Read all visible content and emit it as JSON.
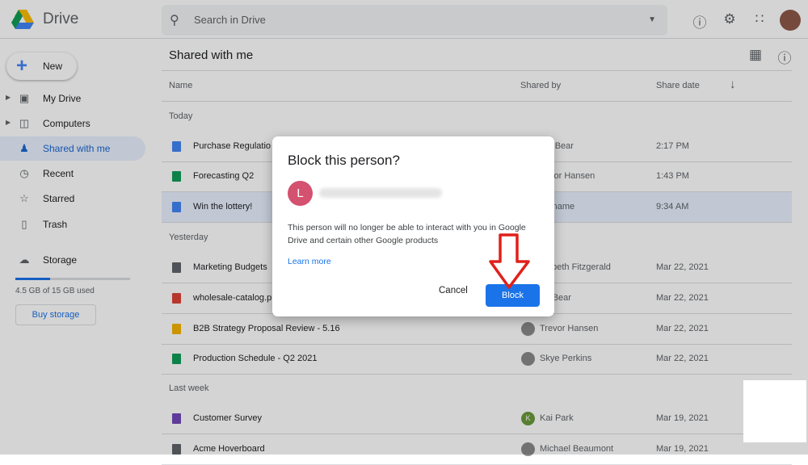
{
  "app": {
    "name": "Drive",
    "search_placeholder": "Search in Drive"
  },
  "sidebar": {
    "new_label": "New",
    "items": [
      {
        "label": "My Drive",
        "icon": "my-drive-icon"
      },
      {
        "label": "Computers",
        "icon": "computer-icon"
      },
      {
        "label": "Shared with me",
        "icon": "people-icon",
        "active": true
      },
      {
        "label": "Recent",
        "icon": "clock-icon"
      },
      {
        "label": "Starred",
        "icon": "star-icon"
      },
      {
        "label": "Trash",
        "icon": "trash-icon"
      },
      {
        "label": "Storage",
        "icon": "cloud-icon"
      }
    ],
    "storage_used": "4.5 GB of 15 GB used",
    "storage_fraction": 0.3,
    "buy_storage": "Buy storage"
  },
  "main": {
    "title": "Shared with me",
    "columns": {
      "name": "Name",
      "shared_by": "Shared by",
      "share_date": "Share date"
    },
    "sections": {
      "today": "Today",
      "yesterday": "Yesterday",
      "last_week": "Last week"
    },
    "rows": [
      {
        "name": "Purchase Regulatio",
        "type": "doc",
        "shared_by": "r Bear",
        "date": "2:17 PM"
      },
      {
        "name": "Forecasting Q2",
        "type": "sheet",
        "shared_by": "vor Hansen",
        "date": "1:43 PM"
      },
      {
        "name": "Win the lottery!",
        "type": "doc",
        "shared_by": "rname",
        "date": "9:34 AM",
        "selected": true
      },
      {
        "name": "Marketing Budgets",
        "type": "shared-folder",
        "shared_by": "abeth Fitzgerald",
        "date": "Mar 22, 2021"
      },
      {
        "name": "wholesale-catalog.p",
        "type": "pdf",
        "shared_by": "r Bear",
        "date": "Mar 22, 2021"
      },
      {
        "name": "B2B Strategy Proposal Review - 5.16",
        "type": "slides",
        "shared_by": "Trevor Hansen",
        "date": "Mar 22, 2021"
      },
      {
        "name": "Production Schedule - Q2 2021",
        "type": "sheet",
        "shared_by": "Skye Perkins",
        "date": "Mar 22, 2021"
      },
      {
        "name": "Customer Survey",
        "type": "form",
        "shared_by": "Kai Park",
        "avatar_letter": "K",
        "date": "Mar 19, 2021"
      },
      {
        "name": "Acme Hoverboard",
        "type": "shared-folder",
        "shared_by": "Michael Beaumont",
        "date": "Mar 19, 2021"
      }
    ]
  },
  "dialog": {
    "title": "Block this person?",
    "avatar_letter": "L",
    "message": "This person will no longer be able to interact with you in Google Drive and certain other Google products",
    "learn_more": "Learn more",
    "cancel": "Cancel",
    "block": "Block"
  },
  "colors": {
    "accent": "#1a73e8",
    "annotation_arrow": "#e0201b",
    "avatar": "#d4516f"
  }
}
